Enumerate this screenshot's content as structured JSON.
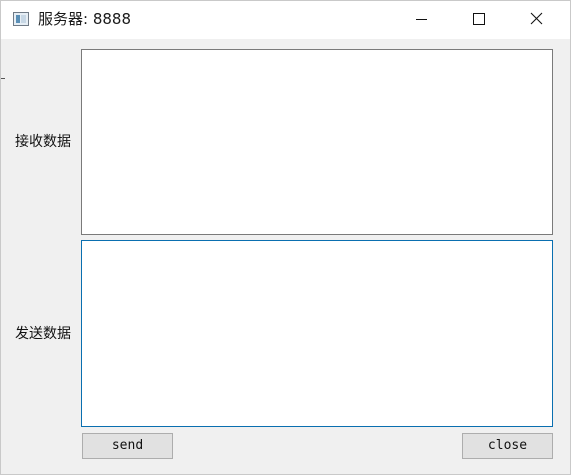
{
  "window": {
    "title": "服务器: 8888",
    "icon": "app-window-icon",
    "controls": {
      "minimize_icon": "minimize-icon",
      "maximize_icon": "maximize-icon",
      "close_icon": "close-icon"
    }
  },
  "form": {
    "receive_label": "接收数据",
    "receive_value": "",
    "send_label": "发送数据",
    "send_value": ""
  },
  "buttons": {
    "send_label": "send",
    "close_label": "close"
  },
  "colors": {
    "title_bar": "#ffffff",
    "client_area": "#f0f0f0",
    "focus_border": "#0a6fb0",
    "button_face": "#e1e1e1"
  }
}
